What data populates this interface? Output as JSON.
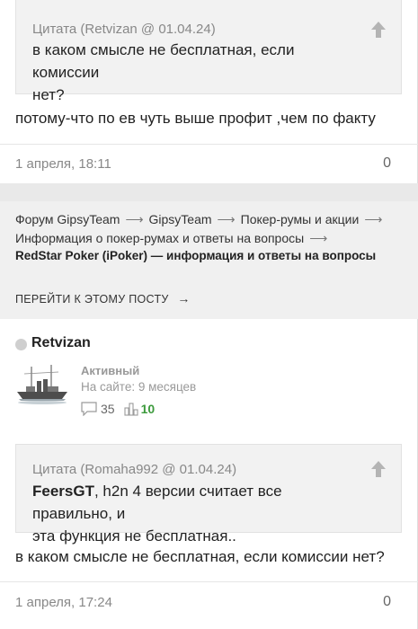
{
  "post1": {
    "quote": {
      "header": "Цитата (Retvizan @ 01.04.24)",
      "lines": [
        "в каком смысле не бесплатная,  если комиссии",
        "нет?"
      ]
    },
    "text": "потому-что по ев чуть выше профит ,чем по факту",
    "date": "1 апреля, 18:11",
    "likes": "0"
  },
  "breadcrumbs": {
    "items": [
      "Форум GipsyTeam",
      "GipsyTeam",
      "Покер-румы и акции",
      "Информация о покер-румах и ответы на вопросы"
    ],
    "topic": "RedStar Poker (iPoker) — информация и ответы на вопросы",
    "goto_label": "ПЕРЕЙТИ К ЭТОМУ ПОСТУ"
  },
  "post2": {
    "author": {
      "name": "Retvizan",
      "rank": "Активный",
      "online": "На сайте: 9 месяцев",
      "posts": "35",
      "likes": "10"
    },
    "quote": {
      "header": "Цитата (Romaha992 @ 01.04.24)",
      "mention": "FeersGT",
      "lines": [
        ", h2n 4 версии считает все правильно, и",
        "эта функция не бесплатная.."
      ]
    },
    "text": "в каком смысле не бесплатная,  если комиссии нет?",
    "date": "1 апреля, 17:24",
    "likes": "0"
  },
  "colors": {
    "likes_green": "#3c9a3c",
    "quote_bg": "#f2f2f2"
  }
}
